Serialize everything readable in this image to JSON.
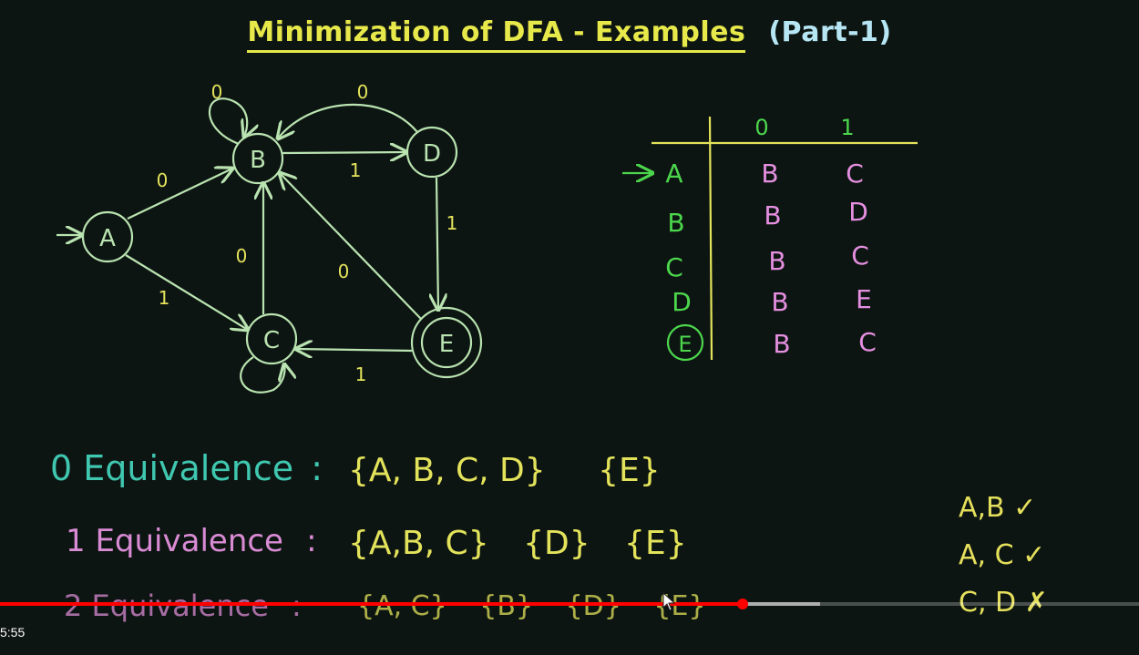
{
  "title": {
    "main": "Minimization of DFA - Examples",
    "part": "(Part-1)"
  },
  "diagram": {
    "states": [
      "A",
      "B",
      "C",
      "D",
      "E"
    ],
    "start_state": "A",
    "final_states": [
      "E"
    ],
    "edge_labels": {
      "b_self": "0",
      "d_to_b": "0",
      "a_to_b": "0",
      "b_to_d": "1",
      "d_to_e": "1",
      "a_to_c": "1",
      "c_to_b": "0",
      "e_to_b": "0",
      "e_to_c": "1"
    }
  },
  "table": {
    "headers": [
      "0",
      "1"
    ],
    "rows": [
      {
        "state": "A",
        "on0": "B",
        "on1": "C"
      },
      {
        "state": "B",
        "on0": "B",
        "on1": "D"
      },
      {
        "state": "C",
        "on0": "B",
        "on1": "C"
      },
      {
        "state": "D",
        "on0": "B",
        "on1": "E"
      },
      {
        "state": "E",
        "on0": "B",
        "on1": "C"
      }
    ]
  },
  "equivalence": [
    {
      "label": "0 Equivalence",
      "sep": ":",
      "sets": [
        "{A, B, C, D}",
        "{E}"
      ],
      "color": "#3fc7b0"
    },
    {
      "label": "1 Equivalence",
      "sep": ":",
      "sets": [
        "{A,B, C}",
        "{D}",
        "{E}"
      ],
      "color": "#d98bd4"
    },
    {
      "label": "2 Equivalence",
      "sep": ":",
      "sets": [
        "{A, C}",
        "{B}",
        "{D}",
        "{E}"
      ],
      "color": "#d98bd4"
    }
  ],
  "pairs": [
    "A,B ✓",
    "A, C ✓",
    "C, D ✗"
  ],
  "colors": {
    "chalk_green": "#b9e3b0",
    "label_yellow": "#e3e35b",
    "state_green": "#4cd64c",
    "entry_pink": "#e58fe0"
  },
  "player": {
    "time": "5:55",
    "progress": 0.652,
    "buffered": 0.72
  }
}
